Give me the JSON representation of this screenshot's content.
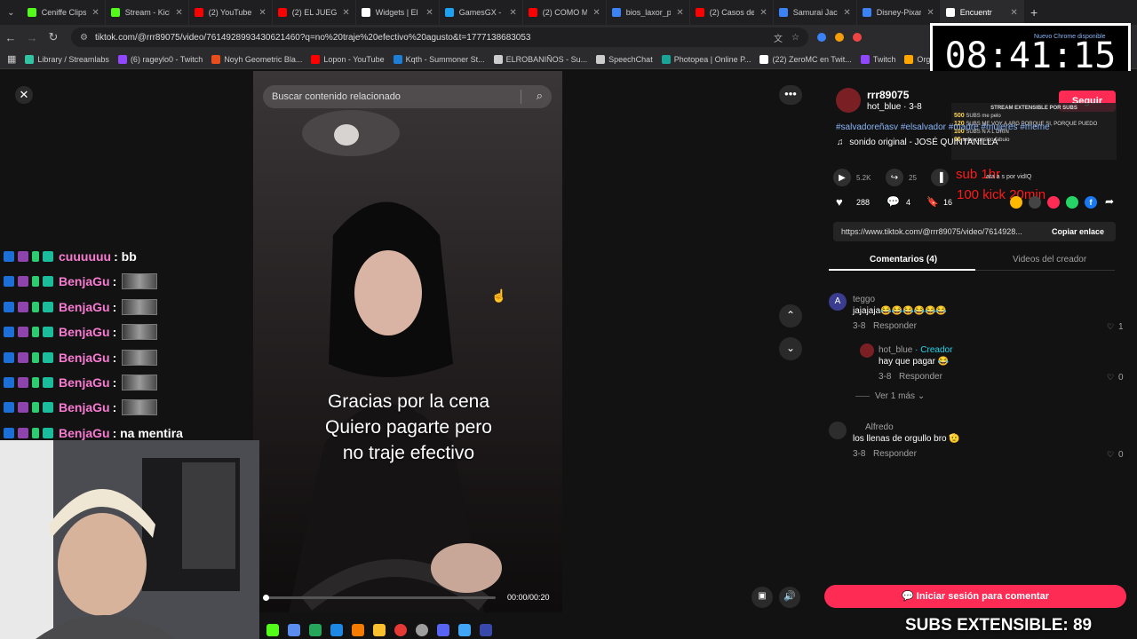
{
  "browser": {
    "tabs": [
      {
        "label": "Ceniffe Clips",
        "color": "#53fc18"
      },
      {
        "label": "Stream - Kick",
        "color": "#53fc18"
      },
      {
        "label": "(2) YouTube",
        "color": "#ff0000"
      },
      {
        "label": "(2) EL JUEGO",
        "color": "#ff0000"
      },
      {
        "label": "Widgets | El",
        "color": "#ffffff"
      },
      {
        "label": "GamesGX - ",
        "color": "#1da1f2"
      },
      {
        "label": "(2) COMO M",
        "color": "#ff0000"
      },
      {
        "label": "bios_laxor_p",
        "color": "#3b82f6"
      },
      {
        "label": "(2) Casos de",
        "color": "#ff0000"
      },
      {
        "label": "Samurai Jack",
        "color": "#3b82f6"
      },
      {
        "label": "Disney-Pixar",
        "color": "#3b82f6"
      },
      {
        "label": "Encuentr",
        "color": "#ffffff",
        "active": true
      }
    ],
    "url": "tiktok.com/@rrr89075/video/7614928993430621460?q=no%20traje%20efectivo%20agusto&t=1777138683053",
    "bookmarks": [
      {
        "label": "Library / Streamlabs",
        "color": "#31c3a2"
      },
      {
        "label": "(6) rageylo0 - Twitch",
        "color": "#9146ff"
      },
      {
        "label": "Noyh Geometric Bla...",
        "color": "#e84e1b"
      },
      {
        "label": "Lopon - YouTube",
        "color": "#ff0000"
      },
      {
        "label": "Kqth - Summoner St...",
        "color": "#1c7ed6"
      },
      {
        "label": "ELROBANIÑOS - Su...",
        "color": "#cccccc"
      },
      {
        "label": "SpeechChat",
        "color": "#cccccc"
      },
      {
        "label": "Photopea | Online P...",
        "color": "#18a497"
      },
      {
        "label": "(22) ZeroMC en Twit...",
        "color": "#ffffff"
      },
      {
        "label": "Twitch",
        "color": "#9146ff"
      },
      {
        "label": "Organizador De Z",
        "color": "#ffa500"
      }
    ]
  },
  "stream": {
    "timer": "08:41:15",
    "chrome_notice": "Nuevo Chrome disponible",
    "widget_title": "STREAM EXTENSIBLE POR SUBS",
    "widget_rows": [
      {
        "subs": "500",
        "label": "SUBS",
        "text": "me pelo"
      },
      {
        "subs": "120",
        "label": "SUBS",
        "text": "ME VOY A ARG PORQUE SI, PORQUE PUEDO"
      },
      {
        "subs": "100",
        "label": "SUBS",
        "text": "N A L DRIN"
      },
      {
        "subs": "95",
        "label": "subs",
        "text": "consigo fabuio"
      }
    ],
    "sub_rule_1": "sub 1hr",
    "sub_rule_2": "100 kick 20min",
    "subs_counter": "SUBS EXTENSIBLE: 89"
  },
  "chat": [
    {
      "user": "cuuuuuu",
      "text": ": bb"
    },
    {
      "user": "BenjaGu",
      "text": ":"
    },
    {
      "user": "BenjaGu",
      "text": ":"
    },
    {
      "user": "BenjaGu",
      "text": ":"
    },
    {
      "user": "BenjaGu",
      "text": ":"
    },
    {
      "user": "BenjaGu",
      "text": ":"
    },
    {
      "user": "BenjaGu",
      "text": ":"
    },
    {
      "user": "BenjaGu",
      "text": ": na mentira"
    }
  ],
  "video": {
    "search_placeholder": "Buscar contenido relacionado",
    "caption_lines": [
      "Gracias por la cena",
      "Quiero pagarte pero",
      "no traje efectivo"
    ],
    "time": "00:00/00:20"
  },
  "author": {
    "username": "rrr89075",
    "nickname": "hot_blue",
    "date": "3-8",
    "follow_label": "Seguir",
    "hashtags": "#salvadoreñasv #elsalvador #madre #mujeres #meme",
    "sound": "sonido original - JOSÉ QUINTANILLA",
    "plays": "5.2K",
    "shares": "25",
    "stitch_label": "ata a     s por vidIQ",
    "likes": "288",
    "comments_count": "4",
    "saves": "16"
  },
  "link": {
    "url": "https://www.tiktok.com/@rrr89075/video/7614928...",
    "copy_label": "Copiar enlace"
  },
  "tabs": {
    "comments": "Comentarios (4)",
    "creator_videos": "Videos del creador"
  },
  "comments": [
    {
      "user": "teggo",
      "avatar_letter": "A",
      "text": "jajajaja😂😂😂😂😂😂",
      "date": "3-8",
      "reply": "Responder",
      "likes": "1"
    },
    {
      "user": "hot_blue",
      "creator": "· Creador",
      "text": "hay que pagar 😂",
      "date": "3-8",
      "reply": "Responder",
      "likes": "0"
    },
    {
      "user": "Alfredo",
      "text": "los llenas de orgullo bro 🫡",
      "date": "3-8",
      "reply": "Responder",
      "likes": "0"
    }
  ],
  "see_more": "Ver 1 más",
  "login_button": "Iniciar sesión para comentar"
}
